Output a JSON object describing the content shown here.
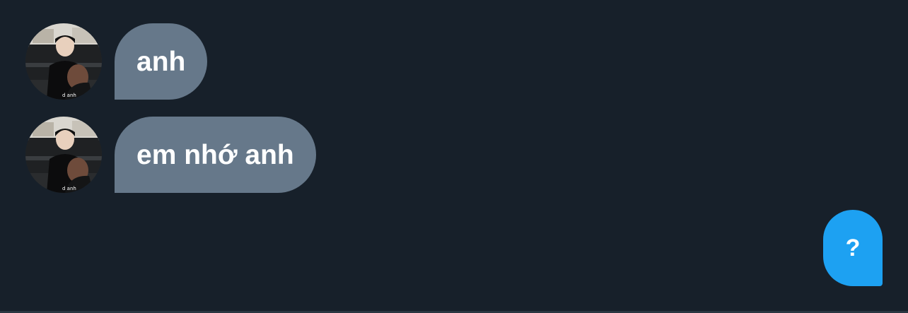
{
  "messages": [
    {
      "text": "anh",
      "avatar": "user-photo-avatar"
    },
    {
      "text": "em nhớ anh",
      "avatar": "user-photo-avatar"
    }
  ],
  "help_button": {
    "label": "?",
    "icon": "question-mark-icon"
  },
  "colors": {
    "background": "#17202a",
    "bubble_received": "#66788a",
    "bubble_text": "#ffffff",
    "accent": "#1da1f2"
  }
}
